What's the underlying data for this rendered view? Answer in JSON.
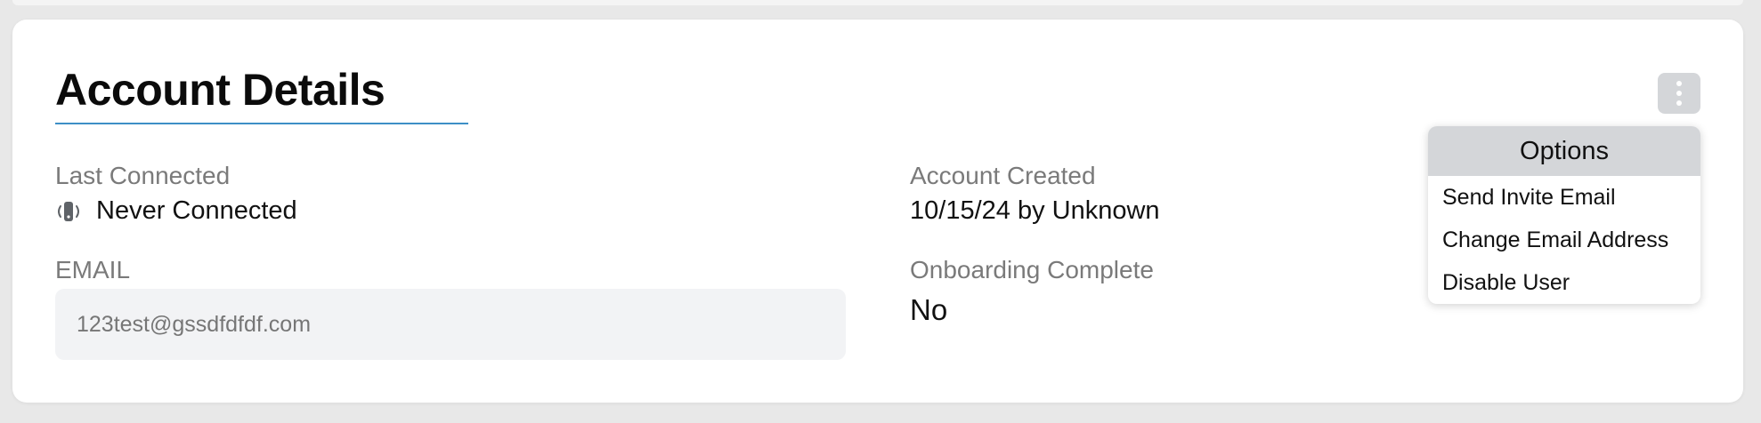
{
  "card": {
    "title": "Account Details"
  },
  "last_connected": {
    "label": "Last Connected",
    "value": "Never Connected",
    "icon": "device-signal-icon"
  },
  "email": {
    "label": "EMAIL",
    "value": "123test@gssdfdfdf.com"
  },
  "account_created": {
    "label": "Account Created",
    "value": "10/15/24 by Unknown"
  },
  "onboarding": {
    "label": "Onboarding Complete",
    "value": "No"
  },
  "options_menu": {
    "trigger_icon": "kebab-menu-icon",
    "header": "Options",
    "items": [
      {
        "label": "Send Invite Email"
      },
      {
        "label": "Change Email Address"
      },
      {
        "label": "Disable User"
      }
    ]
  },
  "colors": {
    "accent_underline": "#3d8fc6",
    "menu_header_bg": "#d4d6d9",
    "field_bg": "#f2f3f5",
    "label_gray": "#7a7a7a"
  }
}
